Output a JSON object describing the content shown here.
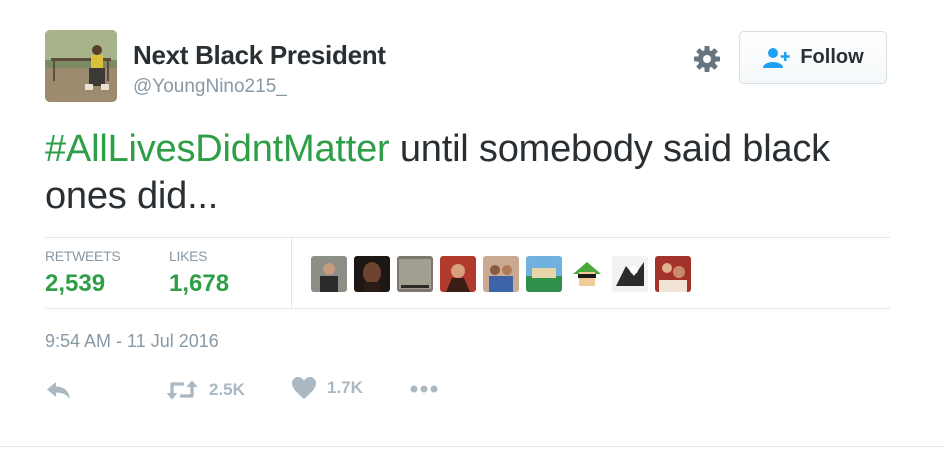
{
  "user": {
    "name": "Next Black President",
    "handle": "@YoungNino215_"
  },
  "header": {
    "follow_label": "Follow"
  },
  "tweet": {
    "hashtag": "#AllLivesDidntMatter",
    "text": " until somebody said black ones did..."
  },
  "stats": {
    "retweets_label": "RETWEETS",
    "retweets_value": "2,539",
    "likes_label": "LIKES",
    "likes_value": "1,678"
  },
  "likers_count": 9,
  "timestamp": "9:54 AM - 11 Jul 2016",
  "actions": {
    "retweet_count": "2.5K",
    "like_count": "1.7K"
  },
  "colors": {
    "accent": "#2e9e47",
    "muted": "#8899a6",
    "follow_icon": "#1da1f2",
    "icon": "#aab8c2"
  },
  "icons": [
    "gear-icon",
    "follow-user-icon",
    "reply-icon",
    "retweet-icon",
    "heart-icon",
    "more-icon"
  ]
}
